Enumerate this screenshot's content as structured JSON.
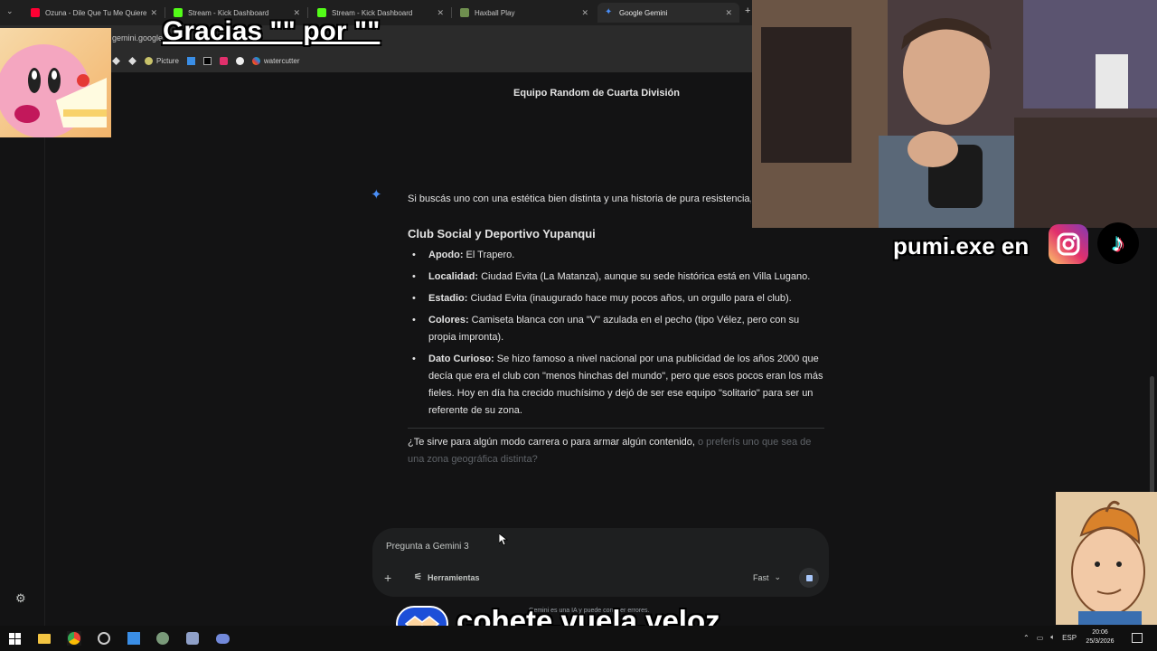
{
  "browser": {
    "tabs": [
      {
        "label": "Ozuna - Dile Que Tu Me Quieres",
        "favicon": "youtube-icon",
        "color": "#ff0033"
      },
      {
        "label": "Stream - Kick Dashboard",
        "favicon": "kick-icon",
        "color": "#53fc18"
      },
      {
        "label": "Stream - Kick Dashboard",
        "favicon": "kick-icon",
        "color": "#53fc18"
      },
      {
        "label": "Haxball Play",
        "favicon": "haxball-icon",
        "color": "#6f8f4f"
      },
      {
        "label": "Google Gemini",
        "favicon": "gemini-icon",
        "color": "#4a8ff8",
        "active": true
      }
    ],
    "new_tab_label": "+",
    "url": "gemini.google.com",
    "bookmarks": [
      {
        "label": "",
        "icon": "diamond-icon"
      },
      {
        "label": "",
        "icon": "diamond-icon"
      },
      {
        "label": "Picture",
        "icon": "picture-icon"
      },
      {
        "label": "",
        "icon": "windows-icon"
      },
      {
        "label": "",
        "icon": "tiktok-icon"
      },
      {
        "label": "",
        "icon": "instagram-icon"
      },
      {
        "label": "",
        "icon": "circle-icon"
      },
      {
        "label": "watercutter",
        "icon": "watercutter-icon"
      }
    ]
  },
  "chat": {
    "title": "Equipo Random de Cuarta División",
    "intro": "Si buscás uno con una estética bien distinta y una historia de pura resistencia, a",
    "club_heading": "Club Social y Deportivo Yupanqui",
    "facts": [
      {
        "label": "Apodo:",
        "text": " El Trapero."
      },
      {
        "label": "Localidad:",
        "text": " Ciudad Evita (La Matanza), aunque su sede histórica está en Villa Lugano."
      },
      {
        "label": "Estadio:",
        "text": " Ciudad Evita (inaugurado hace muy pocos años, un orgullo para el club)."
      },
      {
        "label": "Colores:",
        "text": " Camiseta blanca con una \"V\" azulada en el pecho (tipo Vélez, pero con su propia impronta)."
      },
      {
        "label": "Dato Curioso:",
        "text": " Se hizo famoso a nivel nacional por una publicidad de los años 2000 que decía que era el club con \"menos hinchas del mundo\", pero que esos pocos eran los más fieles. Hoy en día ha crecido muchísimo y dejó de ser ese equipo \"solitario\" para ser un referente de su zona."
      }
    ],
    "followup_main": "¿Te sirve para algún modo carrera o para armar algún contenido,",
    "followup_faded": " o preferís uno que sea de una zona geográfica distinta?"
  },
  "input": {
    "placeholder": "Pregunta a Gemini 3",
    "plus_label": "+",
    "tools_label": "Herramientas",
    "mode_label": "Fast",
    "disclaimer": "Gemini es una IA y puede cometer errores."
  },
  "overlays": {
    "top_caption": "Gracias \"\" por \"\"",
    "social_handle": "pumi.exe en",
    "bottom_caption": "cohete.vuela.veloz"
  },
  "taskbar": {
    "language": "ESP",
    "time": "20:06",
    "date": "25/3/2026"
  },
  "colors": {
    "background": "#131314",
    "accent": "#4a8ff8",
    "text": "#e3e3e3"
  }
}
